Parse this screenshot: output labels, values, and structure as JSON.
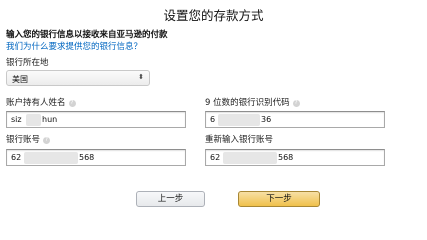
{
  "page": {
    "title": "设置您的存款方式",
    "subhead": "输入您的银行信息以接收来自亚马逊的付款",
    "why_link": "我们为什么要求提供您的银行信息？"
  },
  "country": {
    "label": "银行所在地",
    "value": "美国",
    "caret": "⬍"
  },
  "form": {
    "holder_label": "账户持有人姓名",
    "holder_value": "siz",
    "holder_tail": "hun",
    "routing_label": "9 位数的银行识别代码",
    "routing_value": "6",
    "routing_tail": "36",
    "account_label": "银行账号",
    "account_value": "62",
    "account_tail": "568",
    "confirm_label": "重新输入银行账号",
    "confirm_value": "62",
    "confirm_tail": "568",
    "help_glyph": "?"
  },
  "buttons": {
    "prev_label": "上一步",
    "next_label": "下一步"
  },
  "colors": {
    "link": "#0066c0",
    "next_button": "#f0c14b",
    "prev_button": "#e7e9ec"
  }
}
